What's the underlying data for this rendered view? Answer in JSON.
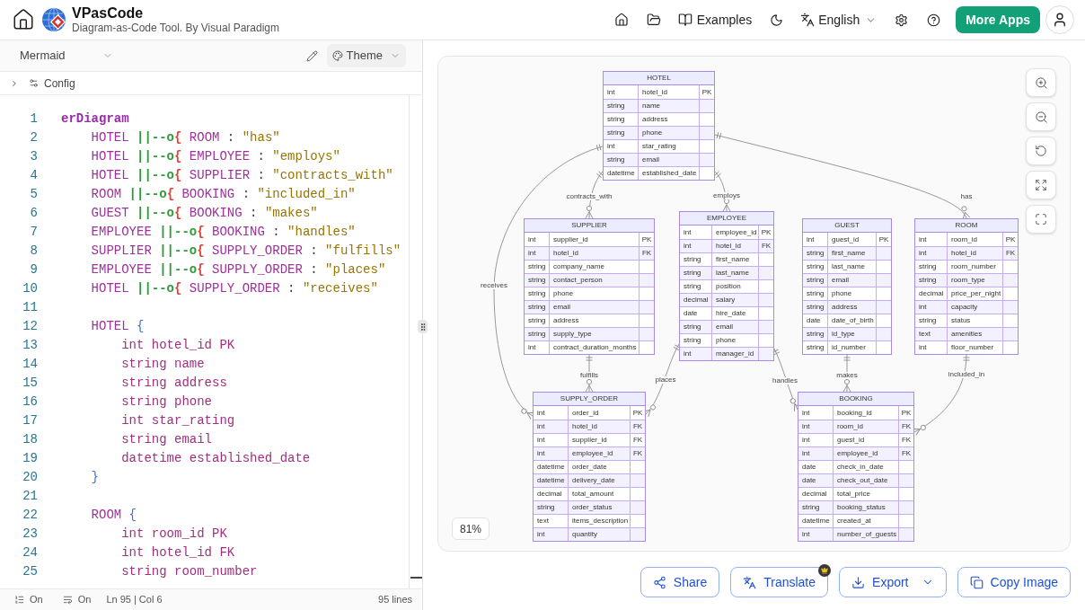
{
  "app": {
    "title": "VPasCode",
    "subtitle": "Diagram-as-Code Tool. By Visual Paradigm"
  },
  "nav": {
    "examples": "Examples",
    "language": "English",
    "more_apps": "More Apps"
  },
  "editor_toolbar": {
    "language": "Mermaid",
    "theme": "Theme"
  },
  "config": {
    "label": "Config",
    "expanded": false
  },
  "code_lines": [
    {
      "number": "1",
      "segments": [
        {
          "kind": "keyword",
          "text": "erDiagram"
        }
      ]
    },
    {
      "number": "2",
      "segments": [
        {
          "kind": "entity",
          "text": "    HOTEL "
        },
        {
          "kind": "relation",
          "text": "||--o"
        },
        {
          "kind": "cardinality",
          "text": "{"
        },
        {
          "kind": "entity",
          "text": " ROOM "
        },
        {
          "kind": "plain",
          "text": ": "
        },
        {
          "kind": "string",
          "text": "\"has\""
        }
      ]
    },
    {
      "number": "3",
      "segments": [
        {
          "kind": "entity",
          "text": "    HOTEL "
        },
        {
          "kind": "relation",
          "text": "||--o"
        },
        {
          "kind": "cardinality",
          "text": "{"
        },
        {
          "kind": "entity",
          "text": " EMPLOYEE "
        },
        {
          "kind": "plain",
          "text": ": "
        },
        {
          "kind": "string",
          "text": "\"employs\""
        }
      ]
    },
    {
      "number": "4",
      "segments": [
        {
          "kind": "entity",
          "text": "    HOTEL "
        },
        {
          "kind": "relation",
          "text": "||--o"
        },
        {
          "kind": "cardinality",
          "text": "{"
        },
        {
          "kind": "entity",
          "text": " SUPPLIER "
        },
        {
          "kind": "plain",
          "text": ": "
        },
        {
          "kind": "string",
          "text": "\"contracts_with\""
        }
      ]
    },
    {
      "number": "5",
      "segments": [
        {
          "kind": "entity",
          "text": "    ROOM "
        },
        {
          "kind": "relation",
          "text": "||--o"
        },
        {
          "kind": "cardinality",
          "text": "{"
        },
        {
          "kind": "entity",
          "text": " BOOKING "
        },
        {
          "kind": "plain",
          "text": ": "
        },
        {
          "kind": "string",
          "text": "\"included_in\""
        }
      ]
    },
    {
      "number": "6",
      "segments": [
        {
          "kind": "entity",
          "text": "    GUEST "
        },
        {
          "kind": "relation",
          "text": "||--o"
        },
        {
          "kind": "cardinality",
          "text": "{"
        },
        {
          "kind": "entity",
          "text": " BOOKING "
        },
        {
          "kind": "plain",
          "text": ": "
        },
        {
          "kind": "string",
          "text": "\"makes\""
        }
      ]
    },
    {
      "number": "7",
      "segments": [
        {
          "kind": "entity",
          "text": "    EMPLOYEE "
        },
        {
          "kind": "relation",
          "text": "||--o"
        },
        {
          "kind": "cardinality",
          "text": "{"
        },
        {
          "kind": "entity",
          "text": " BOOKING "
        },
        {
          "kind": "plain",
          "text": ": "
        },
        {
          "kind": "string",
          "text": "\"handles\""
        }
      ]
    },
    {
      "number": "8",
      "segments": [
        {
          "kind": "entity",
          "text": "    SUPPLIER "
        },
        {
          "kind": "relation",
          "text": "||--o"
        },
        {
          "kind": "cardinality",
          "text": "{"
        },
        {
          "kind": "entity",
          "text": " SUPPLY_ORDER "
        },
        {
          "kind": "plain",
          "text": ": "
        },
        {
          "kind": "string",
          "text": "\"fulfills\""
        }
      ]
    },
    {
      "number": "9",
      "segments": [
        {
          "kind": "entity",
          "text": "    EMPLOYEE "
        },
        {
          "kind": "relation",
          "text": "||--o"
        },
        {
          "kind": "cardinality",
          "text": "{"
        },
        {
          "kind": "entity",
          "text": " SUPPLY_ORDER "
        },
        {
          "kind": "plain",
          "text": ": "
        },
        {
          "kind": "string",
          "text": "\"places\""
        }
      ]
    },
    {
      "number": "10",
      "segments": [
        {
          "kind": "entity",
          "text": "    HOTEL "
        },
        {
          "kind": "relation",
          "text": "||--o"
        },
        {
          "kind": "cardinality",
          "text": "{"
        },
        {
          "kind": "entity",
          "text": " SUPPLY_ORDER "
        },
        {
          "kind": "plain",
          "text": ": "
        },
        {
          "kind": "string",
          "text": "\"receives\""
        }
      ]
    },
    {
      "number": "11"
    },
    {
      "number": "12",
      "segments": [
        {
          "kind": "entity",
          "text": "    HOTEL "
        },
        {
          "kind": "bracket",
          "text": "{"
        }
      ]
    },
    {
      "number": "13",
      "segments": [
        {
          "kind": "attribute",
          "text": "        int hotel_id PK"
        }
      ]
    },
    {
      "number": "14",
      "segments": [
        {
          "kind": "attribute",
          "text": "        string name"
        }
      ]
    },
    {
      "number": "15",
      "segments": [
        {
          "kind": "attribute",
          "text": "        string address"
        }
      ]
    },
    {
      "number": "16",
      "segments": [
        {
          "kind": "attribute",
          "text": "        string phone"
        }
      ]
    },
    {
      "number": "17",
      "segments": [
        {
          "kind": "attribute",
          "text": "        int star_rating"
        }
      ]
    },
    {
      "number": "18",
      "segments": [
        {
          "kind": "attribute",
          "text": "        string email"
        }
      ]
    },
    {
      "number": "19",
      "segments": [
        {
          "kind": "attribute",
          "text": "        datetime established_date"
        }
      ]
    },
    {
      "number": "20",
      "segments": [
        {
          "kind": "bracket",
          "text": "    }"
        }
      ]
    },
    {
      "number": "21"
    },
    {
      "number": "22",
      "segments": [
        {
          "kind": "entity",
          "text": "    ROOM "
        },
        {
          "kind": "bracket",
          "text": "{"
        }
      ]
    },
    {
      "number": "23",
      "segments": [
        {
          "kind": "attribute",
          "text": "        int room_id PK"
        }
      ]
    },
    {
      "number": "24",
      "segments": [
        {
          "kind": "attribute",
          "text": "        int hotel_id FK"
        }
      ]
    },
    {
      "number": "25",
      "segments": [
        {
          "kind": "attribute",
          "text": "        string room_number"
        }
      ]
    }
  ],
  "status_bar": {
    "toggles": [
      {
        "kind": "numbering",
        "label": "On"
      },
      {
        "kind": "wrap",
        "label": "On"
      }
    ],
    "position": "Ln 95 | Col 6",
    "line_count": "95 lines"
  },
  "diagram": {
    "zoom_level": "81%",
    "entities": [
      {
        "name": "HOTEL",
        "attributes": [
          {
            "type": "int",
            "name": "hotel_id",
            "key": "PK"
          },
          {
            "type": "string",
            "name": "name"
          },
          {
            "type": "string",
            "name": "address"
          },
          {
            "type": "string",
            "name": "phone"
          },
          {
            "type": "int",
            "name": "star_rating"
          },
          {
            "type": "string",
            "name": "email"
          },
          {
            "type": "datetime",
            "name": "established_date"
          }
        ]
      },
      {
        "name": "SUPPLIER",
        "attributes": [
          {
            "type": "int",
            "name": "supplier_id",
            "key": "PK"
          },
          {
            "type": "int",
            "name": "hotel_id",
            "key": "FK"
          },
          {
            "type": "string",
            "name": "company_name"
          },
          {
            "type": "string",
            "name": "contact_person"
          },
          {
            "type": "string",
            "name": "phone"
          },
          {
            "type": "string",
            "name": "email"
          },
          {
            "type": "string",
            "name": "address"
          },
          {
            "type": "string",
            "name": "supply_type"
          },
          {
            "type": "int",
            "name": "contract_duration_months"
          }
        ]
      },
      {
        "name": "EMPLOYEE",
        "attributes": [
          {
            "type": "int",
            "name": "employee_id",
            "key": "PK"
          },
          {
            "type": "int",
            "name": "hotel_id",
            "key": "FK"
          },
          {
            "type": "string",
            "name": "first_name"
          },
          {
            "type": "string",
            "name": "last_name"
          },
          {
            "type": "string",
            "name": "position"
          },
          {
            "type": "decimal",
            "name": "salary"
          },
          {
            "type": "date",
            "name": "hire_date"
          },
          {
            "type": "string",
            "name": "email"
          },
          {
            "type": "string",
            "name": "phone"
          },
          {
            "type": "int",
            "name": "manager_id"
          }
        ]
      },
      {
        "name": "GUEST",
        "attributes": [
          {
            "type": "int",
            "name": "guest_id",
            "key": "PK"
          },
          {
            "type": "string",
            "name": "first_name"
          },
          {
            "type": "string",
            "name": "last_name"
          },
          {
            "type": "string",
            "name": "email"
          },
          {
            "type": "string",
            "name": "phone"
          },
          {
            "type": "string",
            "name": "address"
          },
          {
            "type": "date",
            "name": "date_of_birth"
          },
          {
            "type": "string",
            "name": "id_type"
          },
          {
            "type": "string",
            "name": "id_number"
          }
        ]
      },
      {
        "name": "ROOM",
        "attributes": [
          {
            "type": "int",
            "name": "room_id",
            "key": "PK"
          },
          {
            "type": "int",
            "name": "hotel_id",
            "key": "FK"
          },
          {
            "type": "string",
            "name": "room_number"
          },
          {
            "type": "string",
            "name": "room_type"
          },
          {
            "type": "decimal",
            "name": "price_per_night"
          },
          {
            "type": "int",
            "name": "capacity"
          },
          {
            "type": "string",
            "name": "status"
          },
          {
            "type": "text",
            "name": "amenities"
          },
          {
            "type": "int",
            "name": "floor_number"
          }
        ]
      },
      {
        "name": "SUPPLY_ORDER",
        "attributes": [
          {
            "type": "int",
            "name": "order_id",
            "key": "PK"
          },
          {
            "type": "int",
            "name": "hotel_id",
            "key": "FK"
          },
          {
            "type": "int",
            "name": "supplier_id",
            "key": "FK"
          },
          {
            "type": "int",
            "name": "employee_id",
            "key": "FK"
          },
          {
            "type": "datetime",
            "name": "order_date"
          },
          {
            "type": "datetime",
            "name": "delivery_date"
          },
          {
            "type": "decimal",
            "name": "total_amount"
          },
          {
            "type": "string",
            "name": "order_status"
          },
          {
            "type": "text",
            "name": "items_description"
          },
          {
            "type": "int",
            "name": "quantity"
          }
        ]
      },
      {
        "name": "BOOKING",
        "attributes": [
          {
            "type": "int",
            "name": "booking_id",
            "key": "PK"
          },
          {
            "type": "int",
            "name": "room_id",
            "key": "FK"
          },
          {
            "type": "int",
            "name": "guest_id",
            "key": "FK"
          },
          {
            "type": "int",
            "name": "employee_id",
            "key": "FK"
          },
          {
            "type": "date",
            "name": "check_in_date"
          },
          {
            "type": "date",
            "name": "check_out_date"
          },
          {
            "type": "decimal",
            "name": "total_price"
          },
          {
            "type": "string",
            "name": "booking_status"
          },
          {
            "type": "datetime",
            "name": "created_at"
          },
          {
            "type": "int",
            "name": "number_of_guests"
          }
        ]
      }
    ],
    "relationships": [
      {
        "label": "contracts_with"
      },
      {
        "label": "employs"
      },
      {
        "label": "has"
      },
      {
        "label": "receives"
      },
      {
        "label": "fulfills"
      },
      {
        "label": "places"
      },
      {
        "label": "handles"
      },
      {
        "label": "makes"
      },
      {
        "label": "included_in"
      }
    ]
  },
  "actions": [
    {
      "kind": "share",
      "label": "Share",
      "premium": false,
      "menu": false
    },
    {
      "kind": "translate",
      "label": "Translate",
      "premium": true,
      "menu": false
    },
    {
      "kind": "export",
      "label": "Export",
      "premium": false,
      "menu": true
    },
    {
      "kind": "copy",
      "label": "Copy Image",
      "premium": false,
      "menu": false
    }
  ]
}
